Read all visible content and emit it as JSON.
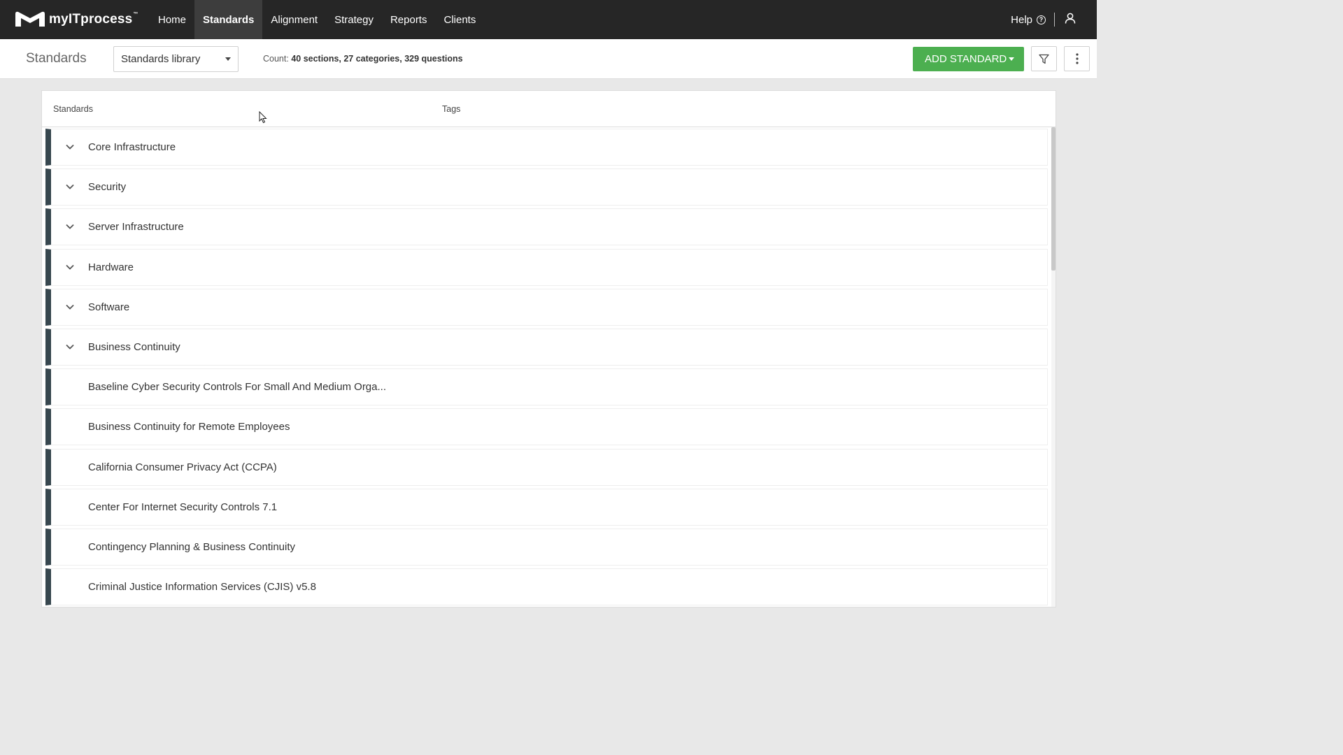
{
  "brand": {
    "name": "myITprocess",
    "trademark": "™"
  },
  "nav": {
    "items": [
      {
        "label": "Home"
      },
      {
        "label": "Standards"
      },
      {
        "label": "Alignment"
      },
      {
        "label": "Strategy"
      },
      {
        "label": "Reports"
      },
      {
        "label": "Clients"
      }
    ],
    "active": "Standards",
    "help_label": "Help"
  },
  "toolbar": {
    "page_title": "Standards",
    "library_select": "Standards library",
    "count_prefix": "Count: ",
    "count_value": "40 sections, 27 categories, 329 questions",
    "add_button": "ADD STANDARD",
    "accent_color": "#4caf50"
  },
  "table": {
    "col_standards": "Standards",
    "col_tags": "Tags",
    "rows": [
      {
        "label": "Core Infrastructure",
        "expandable": true
      },
      {
        "label": "Security",
        "expandable": true
      },
      {
        "label": "Server Infrastructure",
        "expandable": true
      },
      {
        "label": "Hardware",
        "expandable": true
      },
      {
        "label": "Software",
        "expandable": true
      },
      {
        "label": "Business Continuity",
        "expandable": true
      },
      {
        "label": "Baseline Cyber Security Controls For Small And Medium Orga...",
        "expandable": false
      },
      {
        "label": "Business Continuity for Remote Employees",
        "expandable": false
      },
      {
        "label": "California Consumer Privacy Act (CCPA)",
        "expandable": false
      },
      {
        "label": "Center For Internet Security Controls 7.1",
        "expandable": false
      },
      {
        "label": "Contingency Planning & Business Continuity",
        "expandable": false
      },
      {
        "label": "Criminal Justice Information Services (CJIS) v5.8",
        "expandable": false
      }
    ]
  }
}
